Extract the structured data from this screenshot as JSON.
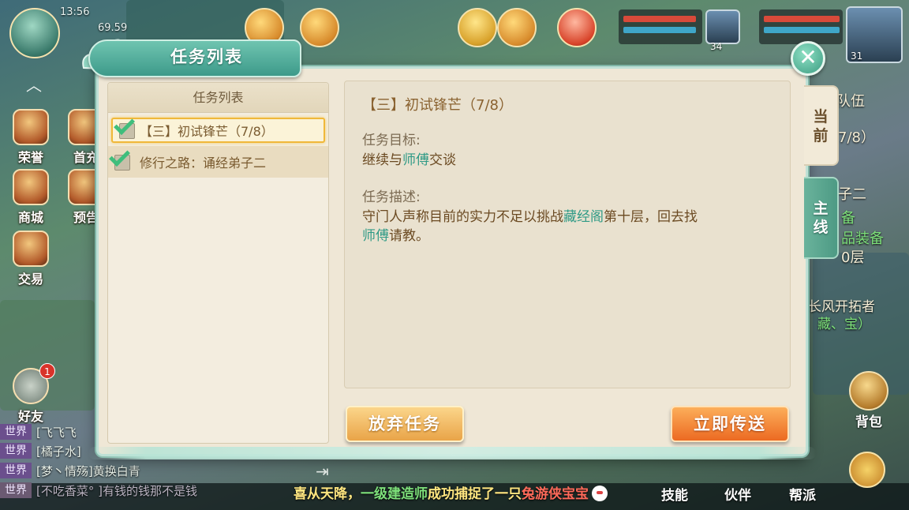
{
  "status_bar": {
    "time": "13:56",
    "battery": "69.59"
  },
  "hud": {
    "player_level_a": "34",
    "player_level_b": "31",
    "left_buttons": [
      "荣誉",
      "首充",
      "商城",
      "预告",
      "交易"
    ],
    "friends": {
      "label": "好友",
      "badge": "1"
    },
    "bag_label": "背包",
    "bottom_menu": [
      "技能",
      "伙伴",
      "帮派"
    ],
    "right_fragments": [
      "队伍",
      "7/8）",
      "子二",
      "备",
      "品装备",
      "0层",
      "长风开拓者",
      "藏、宝）"
    ]
  },
  "chat": [
    {
      "channel": "世界",
      "text": "[飞飞飞"
    },
    {
      "channel": "世界",
      "text": "[橘子水]"
    },
    {
      "channel": "世界",
      "text": "[梦丶情殇]黄换白青"
    },
    {
      "channel": "世界",
      "text": "[不吃香菜° ]有钱的钱那不是钱"
    }
  ],
  "marquee": {
    "prefix": "喜从天降，",
    "player": "一级建造师",
    "middle": "成功捕捉了一只",
    "pet": "兔游侠宝宝"
  },
  "dialog": {
    "title": "任务列表",
    "close_label": "✕",
    "list_header": "任务列表",
    "tasks": [
      {
        "label": "【三】初试锋芒（7/8）",
        "checked": true,
        "selected": true
      },
      {
        "label": "修行之路：诵经弟子二",
        "checked": true,
        "selected": false
      }
    ],
    "tabs": [
      {
        "label": "当前",
        "active": true
      },
      {
        "label": "主线",
        "active": false
      }
    ],
    "detail": {
      "title": "【三】初试锋芒（7/8）",
      "goal_label": "任务目标:",
      "goal_pre": "继续与",
      "goal_link": "师傅",
      "goal_post": "交谈",
      "desc_label": "任务描述:",
      "desc_pre": "守门人声称目前的实力不足以挑战",
      "desc_link1": "藏经阁",
      "desc_mid": "第十层，回去找",
      "desc_link2": "师傅",
      "desc_post": "请教。"
    },
    "buttons": {
      "abandon": "放弃任务",
      "teleport": "立即传送"
    }
  },
  "colors": {
    "accent_teal": "#3d9a8a",
    "link": "#2f9a86",
    "abandon_button": "#e9a448",
    "teleport_button": "#ec6a22",
    "selected_border": "#f0b83a"
  }
}
